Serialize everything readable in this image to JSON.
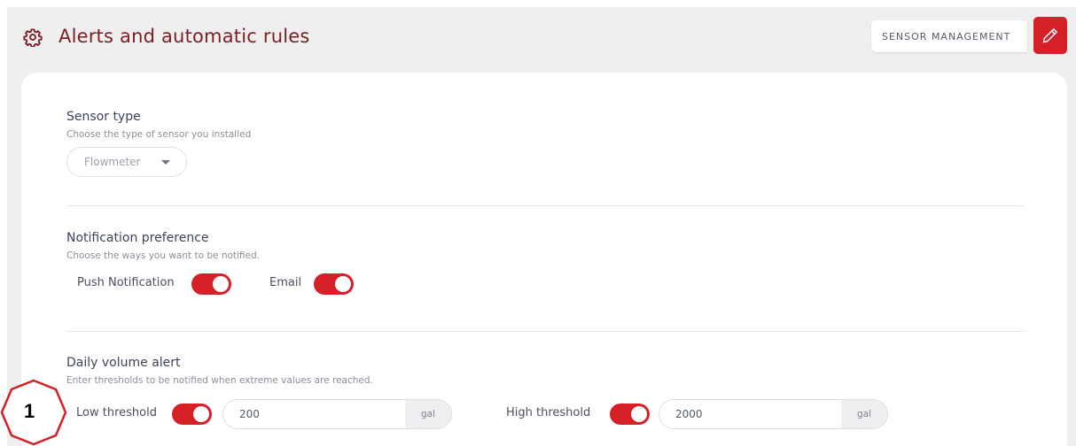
{
  "header": {
    "title": "Alerts and automatic rules",
    "management_label": "SENSOR MANAGEMENT"
  },
  "sensor_type": {
    "title": "Sensor type",
    "subtitle": "Choose the type of sensor you installed",
    "selected": "Flowmeter"
  },
  "notification": {
    "title": "Notification preference",
    "subtitle": "Choose the ways you want to be notified.",
    "push_label": "Push Notification",
    "push_on": true,
    "email_label": "Email",
    "email_on": true
  },
  "daily_volume": {
    "title": "Daily volume alert",
    "subtitle": "Enter thresholds to be notified when extreme values are reached.",
    "low_label": "Low threshold",
    "low_on": true,
    "low_value": "200",
    "low_unit": "gal",
    "high_label": "High threshold",
    "high_on": true,
    "high_value": "2000",
    "high_unit": "gal"
  },
  "annotation": {
    "number": "1"
  },
  "colors": {
    "accent": "#d52028",
    "title": "#7b1e24",
    "background": "#efefef"
  },
  "icons": [
    "gear-icon",
    "pencil-icon",
    "caret-down-icon"
  ]
}
